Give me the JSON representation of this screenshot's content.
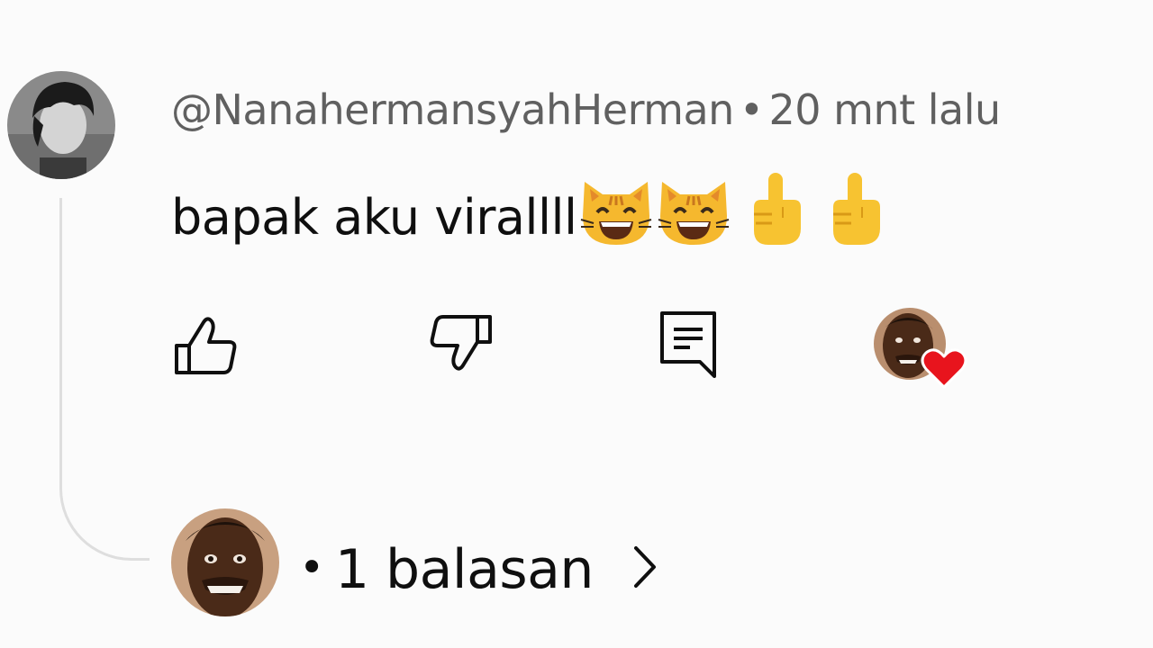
{
  "comment": {
    "author": "@NanahermansyahHerman",
    "separator": "•",
    "timestamp": "20 mnt lalu",
    "text": "bapak aku virallll",
    "emojis": [
      "grinning-cat-emoji",
      "grinning-cat-emoji",
      "pointing-up-emoji",
      "pointing-up-emoji"
    ]
  },
  "actions": {
    "like_icon": "thumbs-up-icon",
    "dislike_icon": "thumbs-down-icon",
    "reply_icon": "comment-reply-icon",
    "creator_heart_icon": "heart-icon"
  },
  "replies": {
    "separator": "•",
    "count_label": "1 balasan",
    "chevron_icon": "chevron-right-icon"
  },
  "colors": {
    "background": "#fbfbfb",
    "text_primary": "#0f0f0f",
    "text_secondary": "#606060",
    "heart": "#e8141d",
    "thread_line": "#dedede"
  }
}
